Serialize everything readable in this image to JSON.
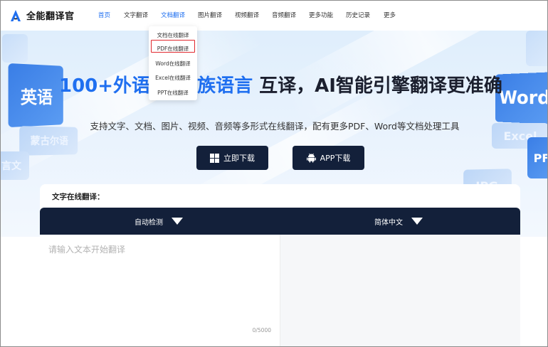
{
  "brand": {
    "name": "全能翻译官",
    "accent": "#1f6ff0"
  },
  "nav": {
    "items": [
      "首页",
      "文字翻译",
      "文档翻译",
      "图片翻译",
      "视频翻译",
      "音频翻译",
      "更多功能",
      "历史记录",
      "更多"
    ]
  },
  "dropdown": {
    "items": [
      "文档在线翻译",
      "PDF在线翻译",
      "Word在线翻译",
      "Excel在线翻译",
      "PPT在线翻译"
    ],
    "highlighted": "PDF在线翻译"
  },
  "hero": {
    "title_blue": "100+外语",
    "title_blue2": "族语言",
    "title_dark": " 互译，AI智能引擎翻译更准确",
    "subtitle": "支持文字、文档、图片、视频、音频等多形式在线翻译，配有更多PDF、Word等文档处理工具",
    "download_label": "立即下载",
    "app_label": "APP下载",
    "bg_tiles": [
      "英语",
      "蒙古尔语",
      "言文",
      "Word",
      "Excel",
      "PF",
      "JPG"
    ]
  },
  "translator": {
    "title": "文字在线翻译：",
    "source_lang": "自动检测",
    "target_lang": "简体中文",
    "placeholder": "请输入文本开始翻译",
    "counter": "0/5000"
  }
}
